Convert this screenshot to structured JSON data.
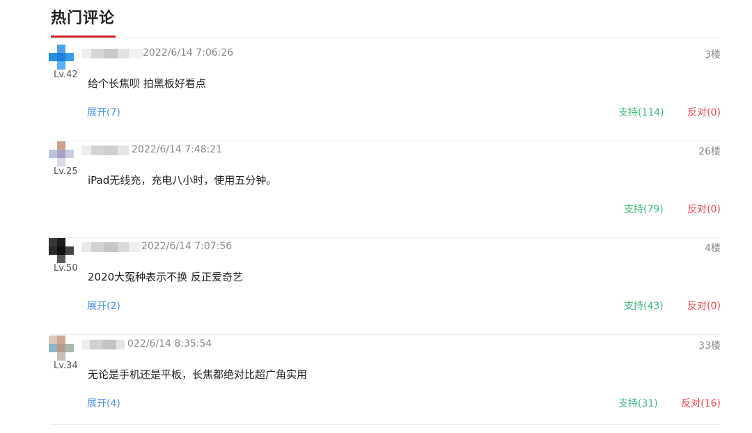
{
  "section": {
    "title": "热门评论"
  },
  "comments": [
    {
      "level": "Lv.42",
      "time": "2022/6/14 7:06:26",
      "floor": "3楼",
      "content": "给个长焦呗 拍黑板好看点",
      "expand": "展开(7)",
      "support": "支持(114)",
      "oppose": "反对(0)"
    },
    {
      "level": "Lv.25",
      "time": "2022/6/14 7:48:21",
      "floor": "26楼",
      "content": "iPad无线充，充电八小时，使用五分钟。",
      "expand": "",
      "support": "支持(79)",
      "oppose": "反对(0)"
    },
    {
      "level": "Lv.50",
      "time": "2022/6/14 7:07:56",
      "floor": "4楼",
      "content": "2020大冤种表示不换 反正爱奇艺",
      "expand": "展开(2)",
      "support": "支持(43)",
      "oppose": "反对(0)"
    },
    {
      "level": "Lv.34",
      "time": "022/6/14 8:35:54",
      "floor": "33楼",
      "content": "无论是手机还是平板，长焦都绝对比超广角实用",
      "expand": "展开(4)",
      "support": "支持(31)",
      "oppose": "反对(16)"
    }
  ],
  "colors": {
    "accent_red": "#d2232a",
    "link_blue": "#4a90e2",
    "support_green": "#3bb87b",
    "oppose_red": "#e8464a",
    "meta_gray": "#888888"
  }
}
